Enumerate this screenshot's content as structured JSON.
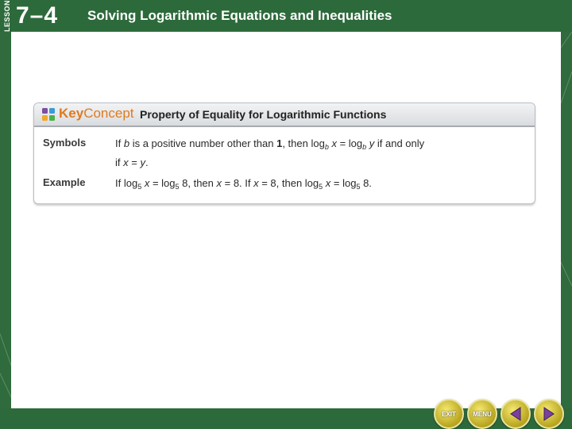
{
  "header": {
    "lesson_label": "LESSON",
    "lesson_number": "7–4",
    "title": "Solving Logarithmic Equations and Inequalities"
  },
  "key_concept": {
    "badge_key": "Key",
    "badge_concept": "Concept",
    "title": "Property of Equality for Logarithmic Functions",
    "rows": [
      {
        "label": "Symbols"
      },
      {
        "label": "Example"
      }
    ]
  },
  "nav": {
    "exit_label": "EXIT",
    "menu_label": "MENU",
    "prev_icon": "triangle-left-icon",
    "next_icon": "triangle-right-icon"
  },
  "colors": {
    "frame_green": "#2d6a3b",
    "accent_orange": "#e07a1e",
    "button_gold": "#c9b42a"
  }
}
